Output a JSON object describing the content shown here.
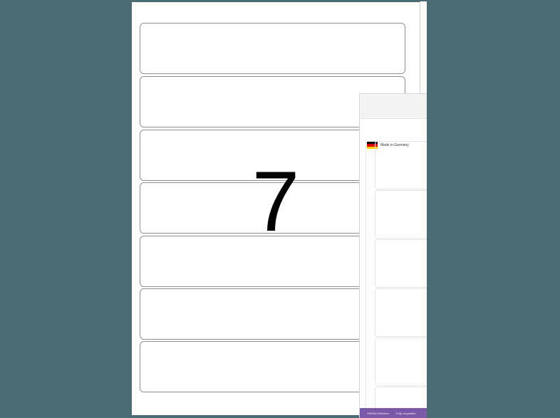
{
  "product": {
    "label_count": "7",
    "label_rows": 7
  },
  "packaging": {
    "badge_text": "Made in Germany",
    "flag_colors": [
      "#000000",
      "#dd0000",
      "#ffce00"
    ],
    "footer_items": [
      "HERMA Etiketten",
      "Fully recyclable"
    ]
  },
  "colors": {
    "background": "#4b6a72",
    "footer": "#7a5aa8"
  }
}
